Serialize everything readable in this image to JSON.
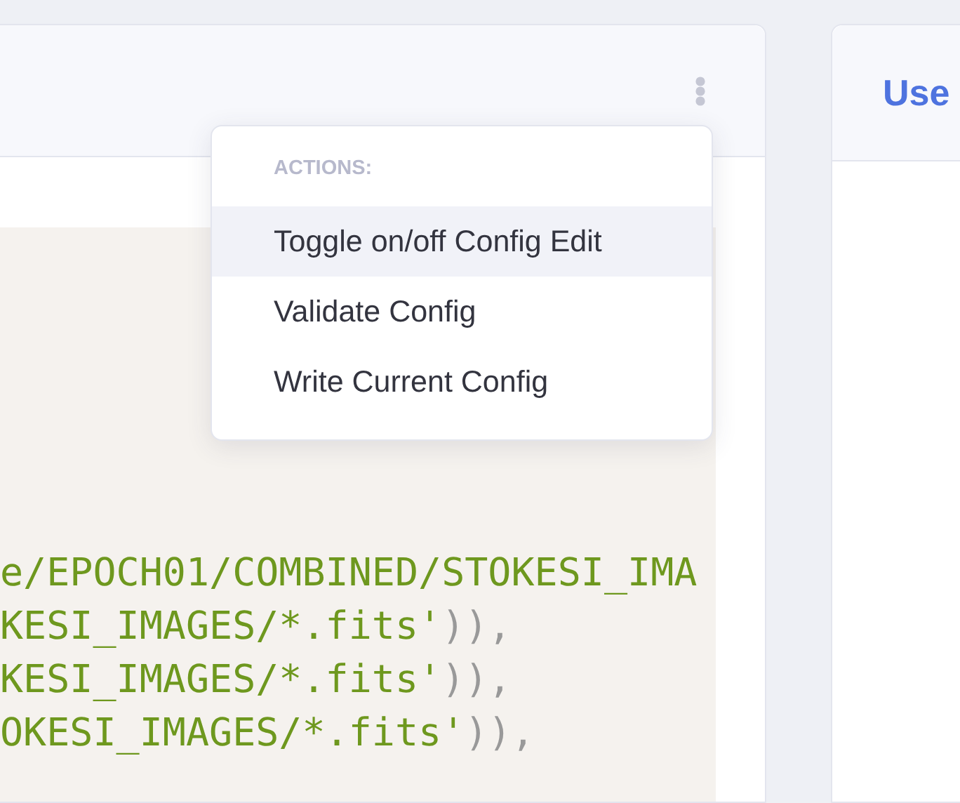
{
  "left_card": {
    "code_lines": [
      [
        {
          "text": "e/EPOCH01/COMBINED/STOKESI_IMA",
          "kind": "string"
        }
      ],
      [
        {
          "text": "KESI_IMAGES/*.fits'",
          "kind": "string"
        },
        {
          "text": ")),",
          "kind": "punct"
        }
      ],
      [
        {
          "text": "KESI_IMAGES/*.fits'",
          "kind": "string"
        },
        {
          "text": ")),",
          "kind": "punct"
        }
      ],
      [
        {
          "text": "OKESI_IMAGES/*.fits'",
          "kind": "string"
        },
        {
          "text": ")),",
          "kind": "punct"
        }
      ]
    ]
  },
  "menu": {
    "header": "ACTIONS:",
    "items": [
      {
        "label": "Toggle on/off Config Edit",
        "selected": true
      },
      {
        "label": "Validate Config",
        "selected": false
      },
      {
        "label": "Write Current Config",
        "selected": false
      }
    ]
  },
  "right_card": {
    "title": "Use"
  }
}
